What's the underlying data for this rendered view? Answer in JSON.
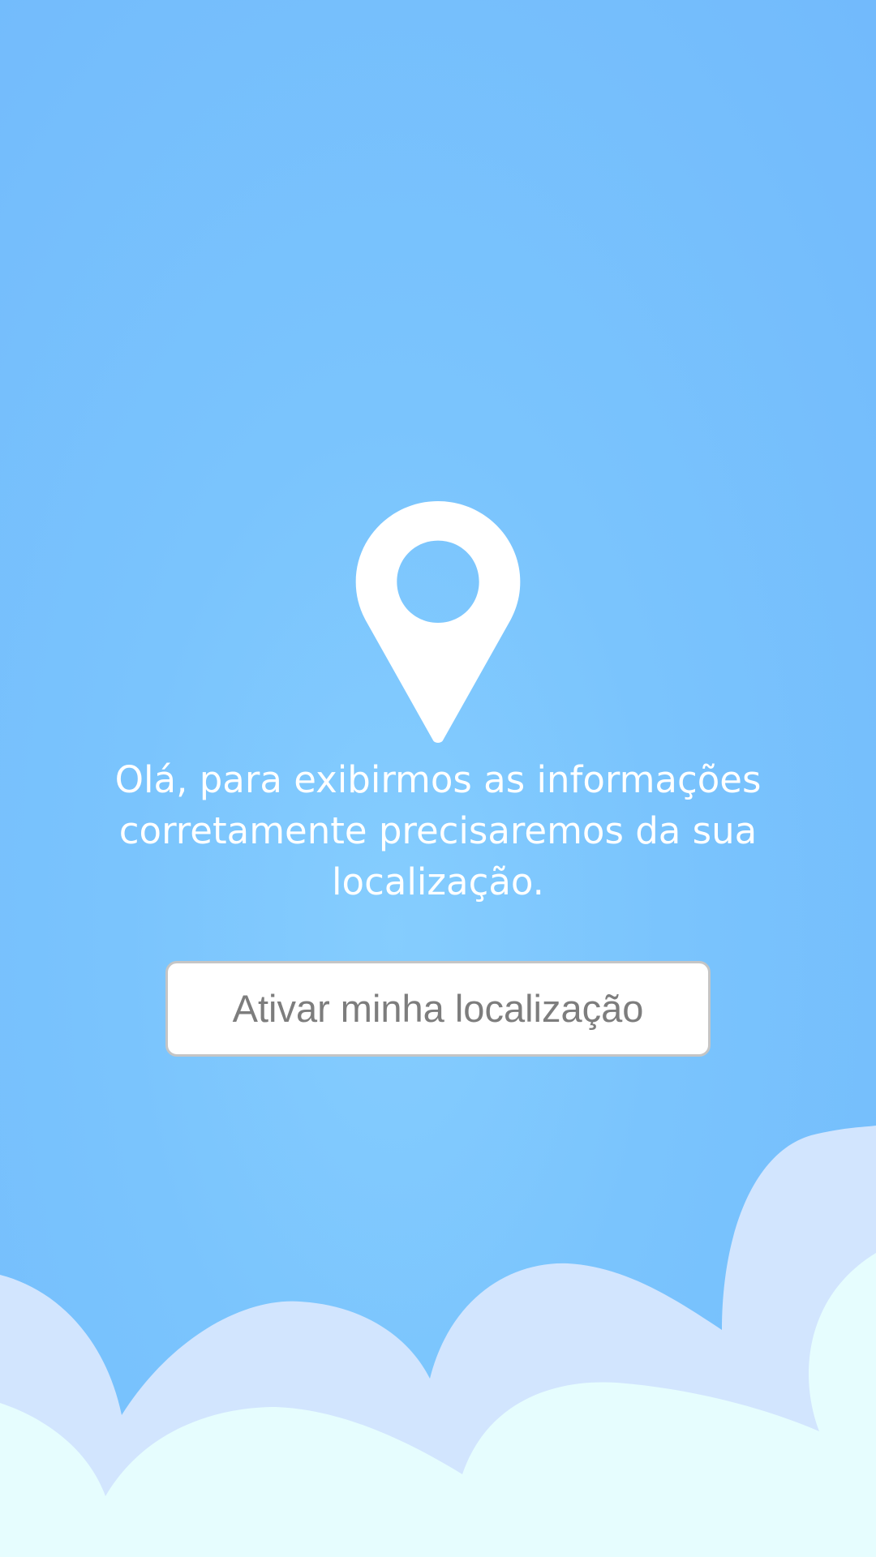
{
  "screen": {
    "message": "Olá, para exibirmos as informações corretamente precisaremos da sua localização.",
    "button_label": "Ativar minha localização"
  },
  "icons": {
    "pin": "location-pin-icon",
    "background": "clouds"
  },
  "colors": {
    "sky": "#7ac4fd",
    "cloud_back": "#d2e5fe",
    "cloud_front": "#e6fdfe",
    "text": "#ffffff",
    "button_bg": "#ffffff",
    "button_text": "#7d7d7d",
    "button_border": "#c5c5c5"
  }
}
